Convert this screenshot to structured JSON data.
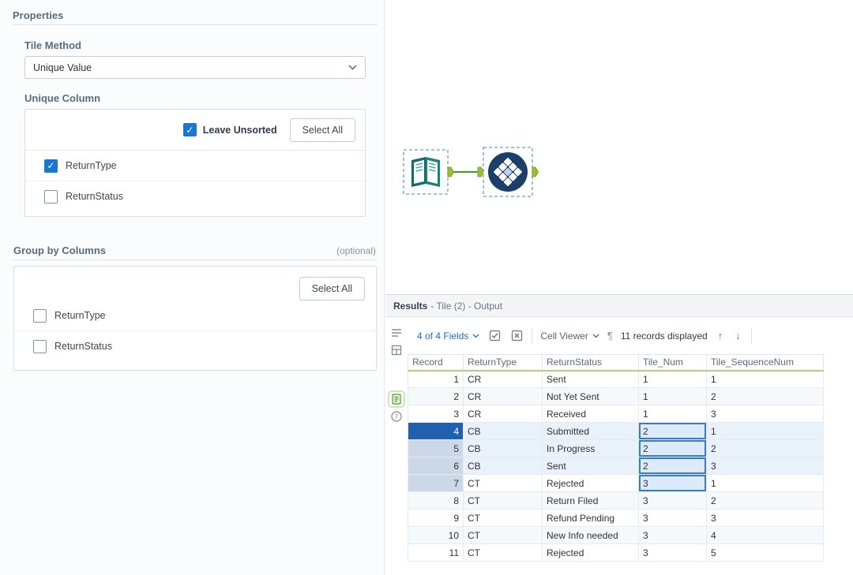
{
  "properties": {
    "title": "Properties",
    "tile_method_label": "Tile Method",
    "tile_method_value": "Unique Value",
    "unique_column_label": "Unique Column",
    "leave_unsorted_label": "Leave Unsorted",
    "select_all_label": "Select All",
    "unique_columns": [
      {
        "label": "ReturnType",
        "checked": true
      },
      {
        "label": "ReturnStatus",
        "checked": false
      }
    ],
    "group_by_label": "Group by Columns",
    "optional_label": "(optional)",
    "group_select_all_label": "Select All",
    "group_columns": [
      {
        "label": "ReturnType",
        "checked": false
      },
      {
        "label": "ReturnStatus",
        "checked": false
      }
    ]
  },
  "canvas": {
    "tools": [
      {
        "name": "Input Data tool",
        "selected": true
      },
      {
        "name": "Tile tool",
        "selected": true
      }
    ],
    "connection_color": "#3aa126",
    "anchor_color": "#9dbf2e",
    "selection_border_color": "#5fa0dc"
  },
  "results": {
    "title": "Results",
    "subtitle": "- Tile (2) - Output",
    "toolbar": {
      "fields_dropdown": "4 of 4 Fields",
      "cell_viewer": "Cell Viewer",
      "records_displayed": "11 records displayed",
      "icons": [
        "select-check-icon",
        "deselect-x-icon",
        "pilcrow-icon",
        "up-arrow-icon",
        "down-arrow-icon"
      ]
    },
    "side_icons": [
      "metadata-list-icon",
      "profile-grid-icon",
      "output-data-icon",
      "help-icon"
    ],
    "table": {
      "columns": [
        "Record",
        "ReturnType",
        "ReturnStatus",
        "Tile_Num",
        "Tile_SequenceNum"
      ],
      "rows": [
        [
          "1",
          "CR",
          "Sent",
          "1",
          "1"
        ],
        [
          "2",
          "CR",
          "Not Yet Sent",
          "1",
          "2"
        ],
        [
          "3",
          "CR",
          "Received",
          "1",
          "3"
        ],
        [
          "4",
          "CB",
          "Submitted",
          "2",
          "1"
        ],
        [
          "5",
          "CB",
          "In Progress",
          "2",
          "2"
        ],
        [
          "6",
          "CB",
          "Sent",
          "2",
          "3"
        ],
        [
          "7",
          "CT",
          "Rejected",
          "3",
          "1"
        ],
        [
          "8",
          "CT",
          "Return Filed",
          "3",
          "2"
        ],
        [
          "9",
          "CT",
          "Refund Pending",
          "3",
          "3"
        ],
        [
          "10",
          "CT",
          "New Info needed",
          "3",
          "4"
        ],
        [
          "11",
          "CT",
          "Rejected",
          "3",
          "5"
        ]
      ],
      "selection": {
        "record_highlight_rows": [
          4,
          5,
          6,
          7
        ],
        "active_record_row": 4,
        "tinted_rows": [
          4,
          5,
          6
        ],
        "selected_cells_column": "Tile_Num",
        "selected_cells_rows": [
          4,
          5,
          6,
          7
        ]
      }
    }
  },
  "colors": {
    "accent_blue": "#1877d2",
    "header_green": "#a9d478",
    "selection_dark_blue": "#1f61ae",
    "selection_light_blue": "#ccd8e8",
    "cell_border_blue": "#3a7cc4"
  }
}
